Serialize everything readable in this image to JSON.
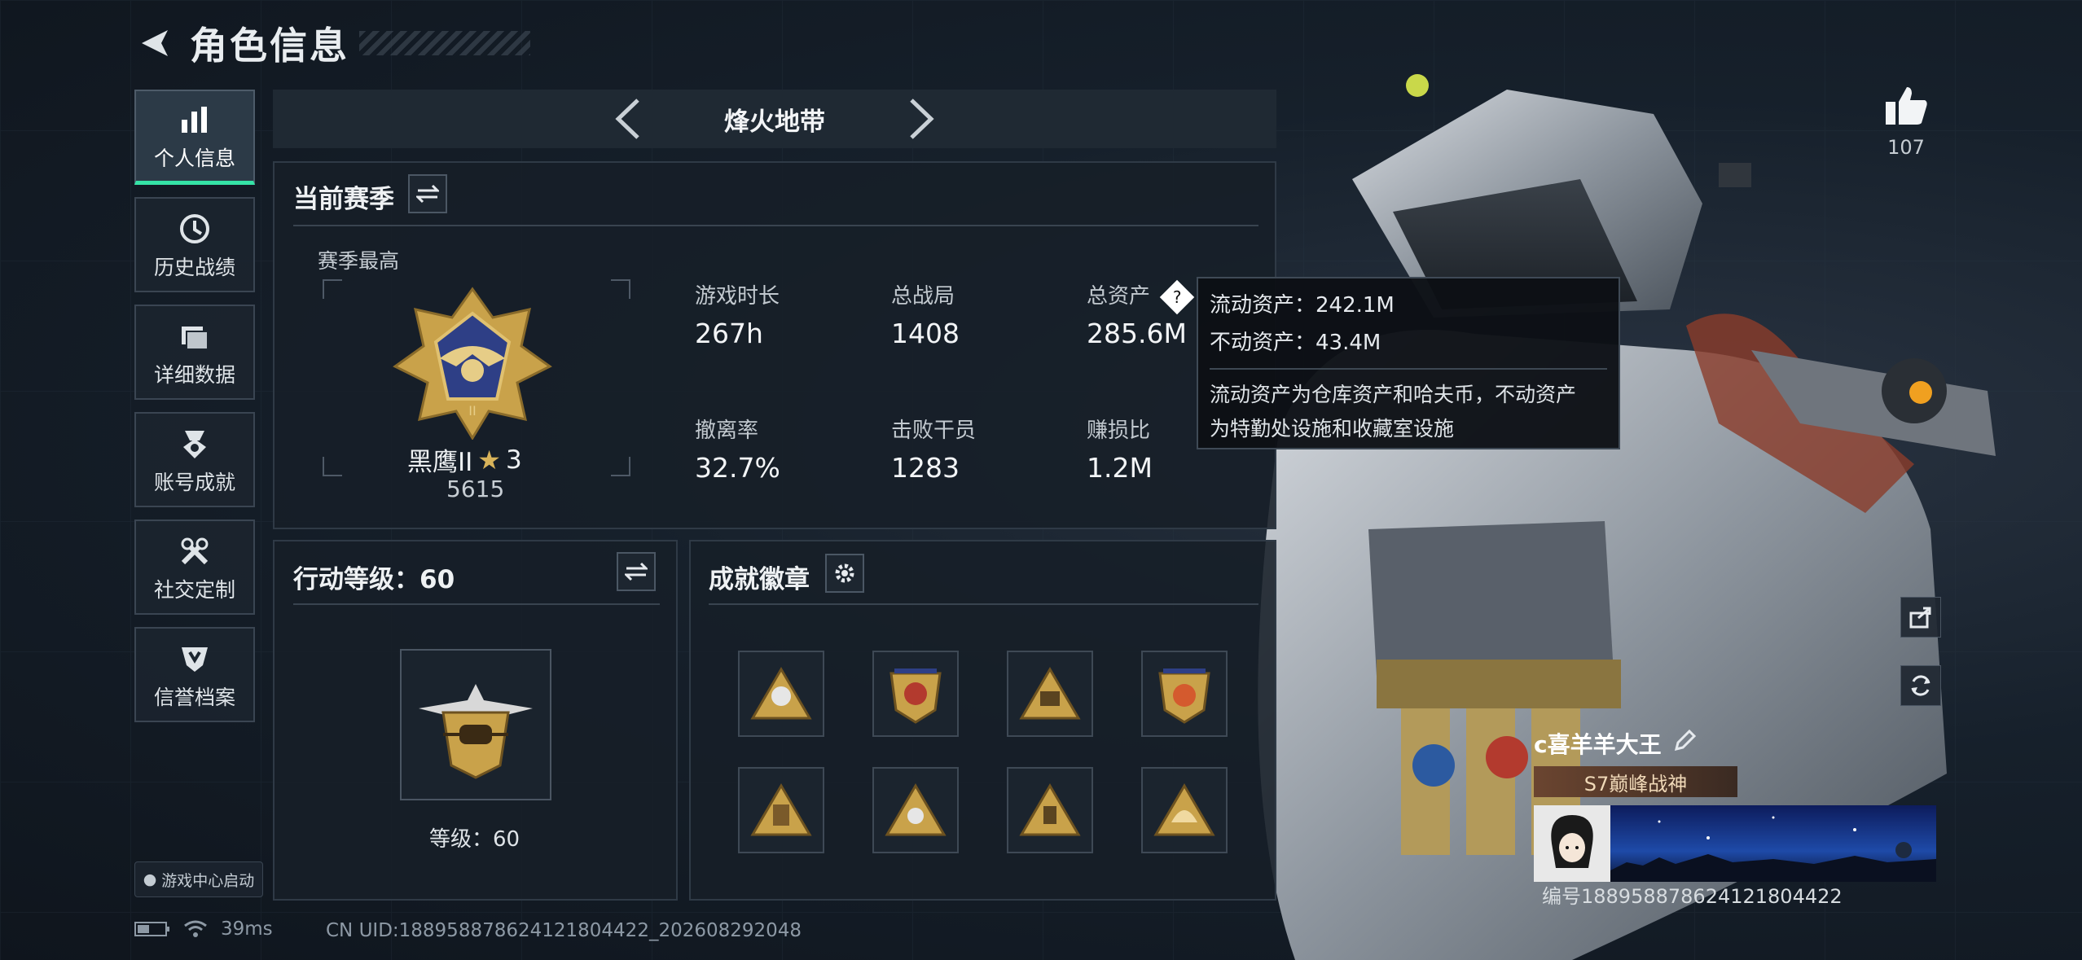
{
  "header": {
    "title": "角色信息"
  },
  "sidenav": [
    {
      "label": "个人信息",
      "icon": "bar-chart-icon",
      "active": true
    },
    {
      "label": "历史战绩",
      "icon": "clock-icon"
    },
    {
      "label": "详细数据",
      "icon": "folder-icon"
    },
    {
      "label": "账号成就",
      "icon": "medal-icon"
    },
    {
      "label": "社交定制",
      "icon": "wrench-icon"
    },
    {
      "label": "信誉档案",
      "icon": "shield-icon"
    }
  ],
  "game_center": "游戏中心启动",
  "mode": {
    "title": "烽火地带"
  },
  "season": {
    "title": "当前赛季",
    "best_label": "赛季最高",
    "rank_name": "黑鹰II",
    "rank_stars": "3",
    "rank_score": "5615"
  },
  "stats": [
    {
      "label": "游戏时长",
      "value": "267h"
    },
    {
      "label": "总战局",
      "value": "1408"
    },
    {
      "label": "总资产",
      "value": "285.6M"
    },
    {
      "label": "撤离率",
      "value": "32.7%"
    },
    {
      "label": "击败干员",
      "value": "1283"
    },
    {
      "label": "赚损比",
      "value": "1.2M"
    }
  ],
  "tooltip": {
    "liquid": "流动资产：242.1M",
    "fixed": "不动资产：43.4M",
    "desc_line1": "流动资产为仓库资产和哈夫币，不动资产",
    "desc_line2": "为特勤处设施和收藏室设施"
  },
  "action_level": {
    "title": "行动等级：60",
    "level_text": "等级：60"
  },
  "badges": {
    "title": "成就徽章",
    "count": 8
  },
  "likes": {
    "count": "107"
  },
  "profile": {
    "name": "c喜羊羊大王",
    "title_badge": "S7巅峰战神",
    "uid_line": "编号188958878624121804422"
  },
  "statusbar": {
    "ping": "39ms"
  },
  "footer_uid": "CN UID:188958878624121804422_202608292048",
  "colors": {
    "accent": "#35e3a6",
    "gold": "#c9a24a"
  }
}
